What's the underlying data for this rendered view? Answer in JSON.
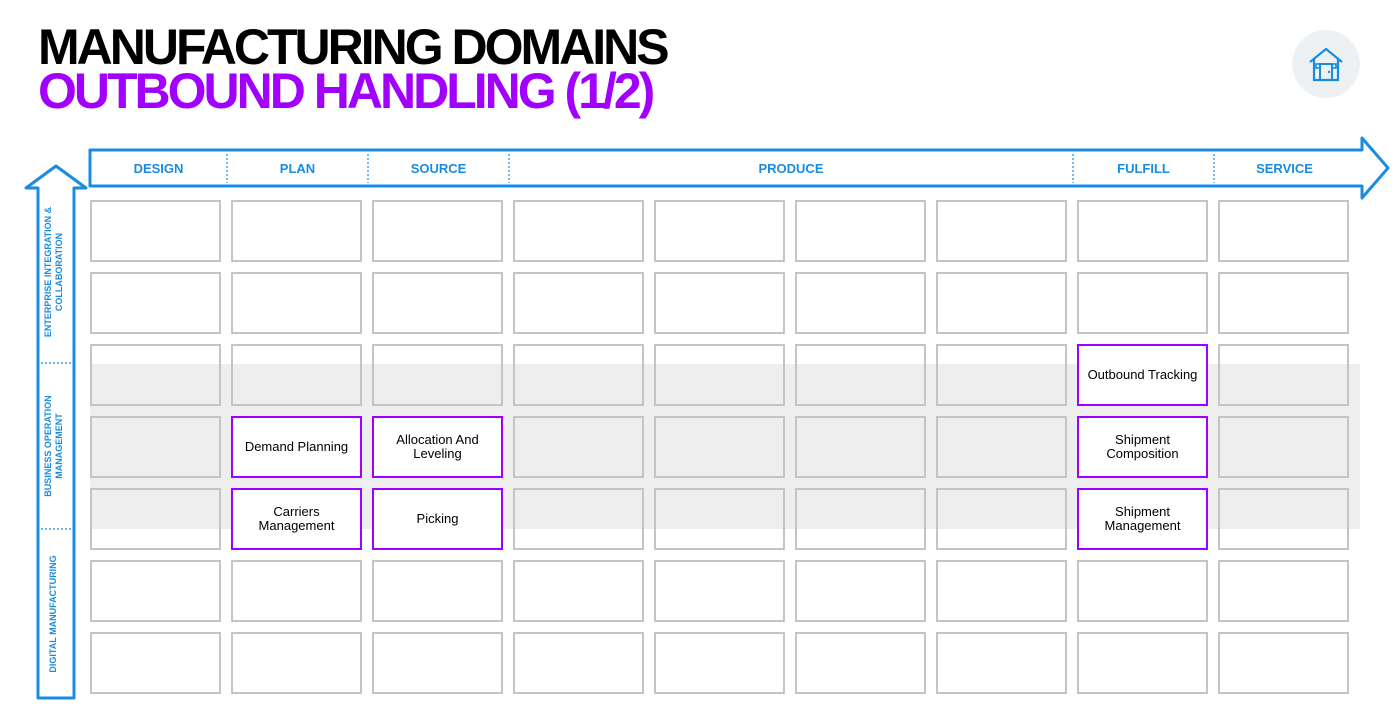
{
  "title": "MANUFACTURING DOMAINS",
  "subtitle": "OUTBOUND HANDLING (1/2)",
  "home_icon": "home-icon",
  "colors": {
    "accent_blue": "#1a8ce0",
    "accent_purple": "#a100ff",
    "cell_border": "#c4c4c4",
    "band_fill": "#eeeeee"
  },
  "columns": [
    "DESIGN",
    "PLAN",
    "SOURCE",
    "PRODUCE",
    "FULFILL",
    "SERVICE"
  ],
  "rows": [
    "ENTERPRISE INTEGRATION & COLLABORATION",
    "BUSINESS OPERATION MANAGEMENT",
    "DIGITAL MANUFACTURING"
  ],
  "cells": {
    "outbound_tracking": "Outbound Tracking",
    "demand_planning": "Demand Planning",
    "allocation_leveling": "Allocation And Leveling",
    "shipment_composition": "Shipment Composition",
    "carriers_management": "Carriers Management",
    "picking": "Picking",
    "shipment_management": "Shipment Management"
  }
}
